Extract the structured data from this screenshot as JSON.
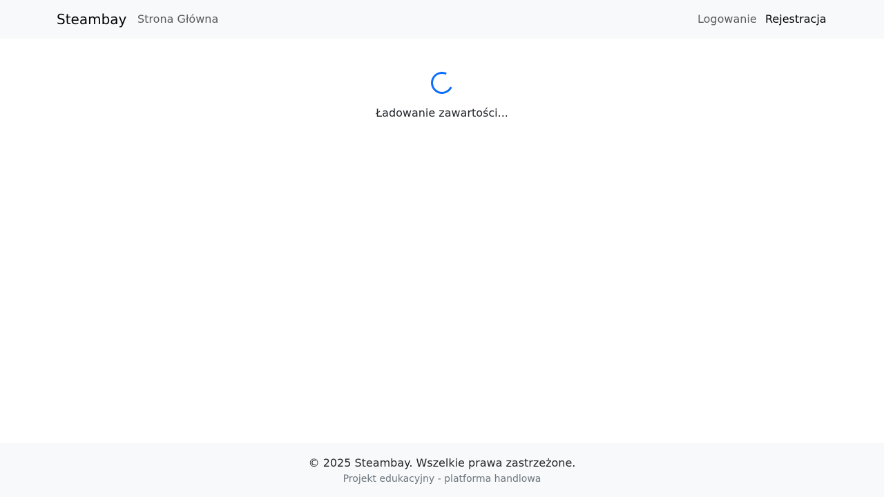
{
  "navbar": {
    "brand": "Steambay",
    "links": {
      "home": "Strona Główna",
      "login": "Logowanie",
      "register": "Rejestracja"
    }
  },
  "main": {
    "loading_text": "Ładowanie zawartości...",
    "spinner_color": "#0d6efd"
  },
  "footer": {
    "copyright": "© 2025 Steambay. Wszelkie prawa zastrzeżone.",
    "subtitle": "Projekt edukacyjny - platforma handlowa"
  }
}
